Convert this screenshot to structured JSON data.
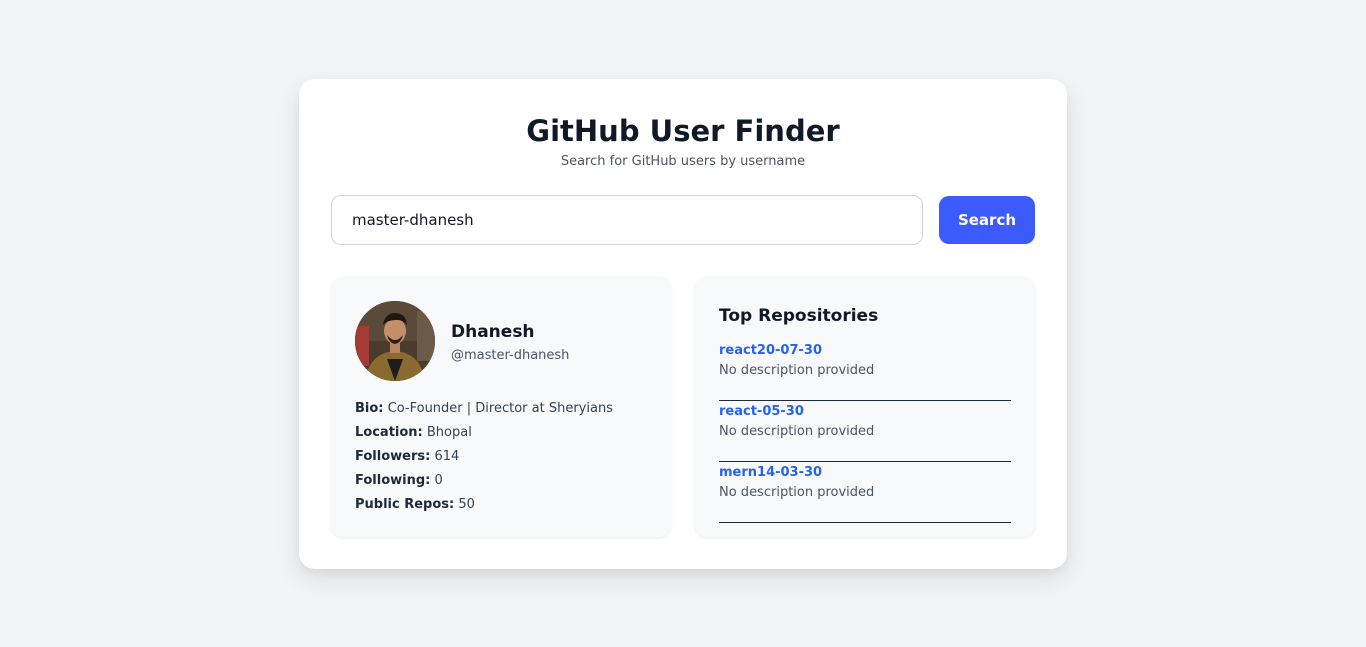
{
  "header": {
    "title": "GitHub User Finder",
    "subtitle": "Search for GitHub users by username"
  },
  "search": {
    "value": "master-dhanesh",
    "button_label": "Search"
  },
  "profile": {
    "name": "Dhanesh",
    "handle": "@master-dhanesh",
    "fields": [
      {
        "label": "Bio:",
        "value": "Co-Founder | Director at Sheryians"
      },
      {
        "label": "Location:",
        "value": "Bhopal"
      },
      {
        "label": "Followers:",
        "value": "614"
      },
      {
        "label": "Following:",
        "value": "0"
      },
      {
        "label": "Public Repos:",
        "value": "50"
      }
    ]
  },
  "repositories": {
    "title": "Top Repositories",
    "items": [
      {
        "name": "react20-07-30",
        "description": "No description provided"
      },
      {
        "name": "react-05-30",
        "description": "No description provided"
      },
      {
        "name": "mern14-03-30",
        "description": "No description provided"
      }
    ]
  },
  "colors": {
    "accent": "#3b5bfd",
    "link": "#2563eb",
    "background": "#f3f4f6"
  }
}
